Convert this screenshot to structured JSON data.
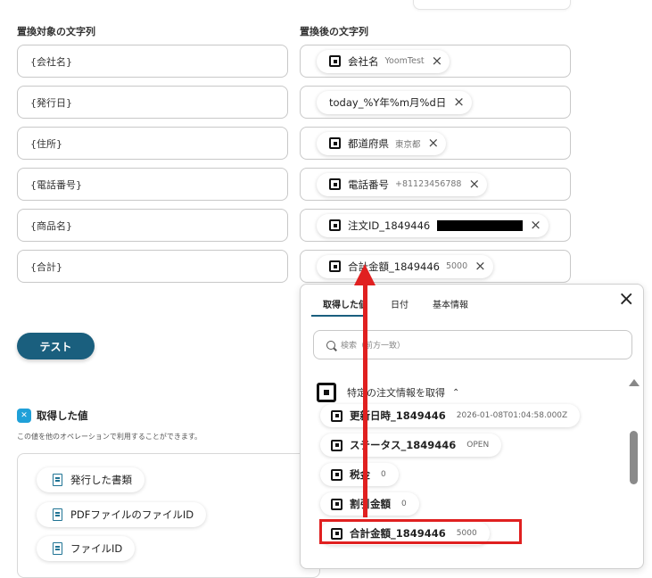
{
  "headers": {
    "left": "置換対象の文字列",
    "right": "置換後の文字列"
  },
  "rows": [
    {
      "target": "{会社名}",
      "type": "chip",
      "label": "会社名",
      "value": "YoomTest"
    },
    {
      "target": "{発行日}",
      "type": "plain",
      "label": "today_%Y年%m月%d日",
      "value": ""
    },
    {
      "target": "{住所}",
      "type": "chip",
      "label": "都道府県",
      "value": "東京都"
    },
    {
      "target": "{電話番号}",
      "type": "chip",
      "label": "電話番号",
      "value": "+81123456788"
    },
    {
      "target": "{商品名}",
      "type": "redacted",
      "label": "注文ID_1849446",
      "value": ""
    },
    {
      "target": "{合計}",
      "type": "chip",
      "label": "合計金額_1849446",
      "value": "5000"
    }
  ],
  "test_button": "テスト",
  "output": {
    "title": "取得した値",
    "description": "この値を他のオペレーションで利用することができます。",
    "items": [
      "発行した書類",
      "PDFファイルのファイルID",
      "ファイルID"
    ]
  },
  "popup": {
    "tabs": [
      "取得した値",
      "日付",
      "基本情報"
    ],
    "search_placeholder": "検索（前方一致）",
    "group_title": "特定の注文情報を取得",
    "items": [
      {
        "label": "更新日時_1849446",
        "value": "2026-01-08T01:04:58.000Z"
      },
      {
        "label": "ステータス_1849446",
        "value": "OPEN"
      },
      {
        "label": "税金",
        "value": "0"
      },
      {
        "label": "割引金額",
        "value": "0"
      },
      {
        "label": "合計金額_1849446",
        "value": "5000"
      }
    ]
  },
  "colors": {
    "accent": "#1a5f7e",
    "annotation_red": "#e02020"
  }
}
